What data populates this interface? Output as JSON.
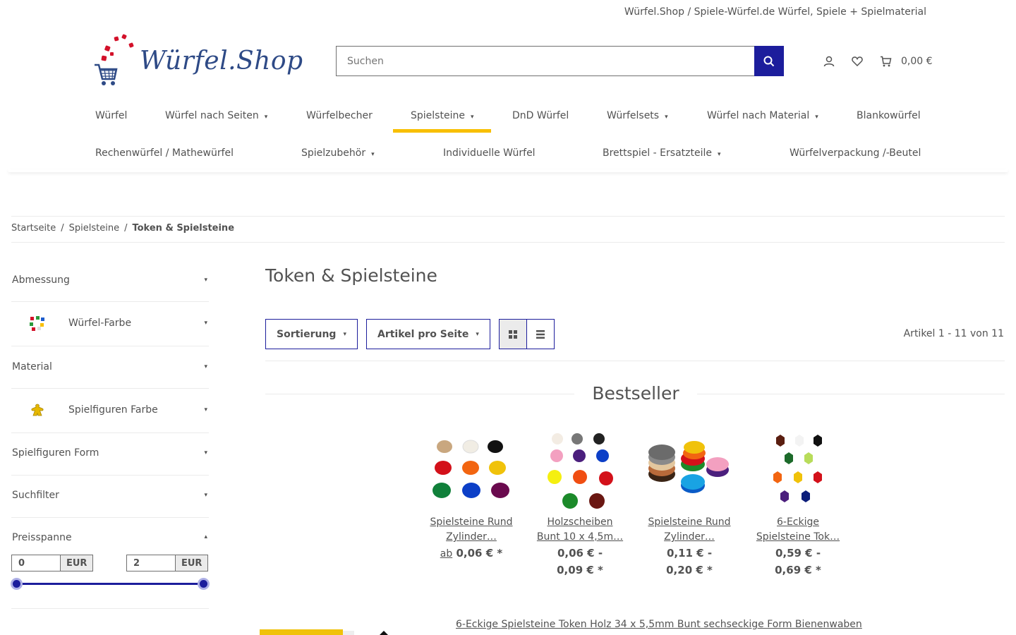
{
  "topbar": {
    "text": "Würfel.Shop / Spiele-Würfel.de Würfel, Spiele + Spielmaterial"
  },
  "logo": {
    "text": "Würfel.Shop"
  },
  "search": {
    "placeholder": "Suchen",
    "icon": "search-icon"
  },
  "header_icons": {
    "user": "user-icon",
    "wishlist": "heart-icon",
    "cart": "cart-icon",
    "cart_total": "0,00 €"
  },
  "nav": {
    "row1": [
      {
        "label": "Würfel",
        "has_children": false
      },
      {
        "label": "Würfel nach Seiten",
        "has_children": true
      },
      {
        "label": "Würfelbecher",
        "has_children": false
      },
      {
        "label": "Spielsteine",
        "has_children": true,
        "active": true
      },
      {
        "label": "DnD Würfel",
        "has_children": false
      },
      {
        "label": "Würfelsets",
        "has_children": true
      },
      {
        "label": "Würfel nach Material",
        "has_children": true
      },
      {
        "label": "Blankowürfel",
        "has_children": false
      }
    ],
    "row2": [
      {
        "label": "Rechenwürfel / Mathewürfel",
        "has_children": false
      },
      {
        "label": "Spielzubehör",
        "has_children": true
      },
      {
        "label": "Individuelle Würfel",
        "has_children": false
      },
      {
        "label": "Brettspiel - Ersatzteile",
        "has_children": true
      },
      {
        "label": "Würfelverpackung /-Beutel",
        "has_children": false
      }
    ],
    "accent_color": "#f8bf00"
  },
  "breadcrumb": {
    "items": [
      "Startseite",
      "Spielsteine",
      "Token & Spielsteine"
    ],
    "separator": "/"
  },
  "filters": [
    {
      "label": "Abmessung",
      "icon": null
    },
    {
      "label": "Würfel-Farbe",
      "icon": "colored-dice-icon"
    },
    {
      "label": "Material",
      "icon": null
    },
    {
      "label": "Spielfiguren Farbe",
      "icon": "meeple-icon"
    },
    {
      "label": "Spielfiguren Form",
      "icon": null
    },
    {
      "label": "Suchfilter",
      "icon": null
    },
    {
      "label": "Preisspanne",
      "icon": null
    }
  ],
  "price_range": {
    "min": "0",
    "max": "2",
    "currency": "EUR",
    "slider_min_fraction": 0,
    "slider_max_fraction": 1
  },
  "main": {
    "title": "Token & Spielsteine",
    "sort_label": "Sortierung",
    "per_page_label": "Artikel pro Seite",
    "view_grid_icon": "grid-icon",
    "view_list_icon": "list-icon",
    "count_text": "Artikel 1 - 11 von 11",
    "bestseller_heading": "Bestseller"
  },
  "products": [
    {
      "name1": "Spielsteine Rund",
      "name2": "Zylinder…",
      "prefix": "ab",
      "price1": "0,06 € *",
      "price2": ""
    },
    {
      "name1": "Holzscheiben",
      "name2": "Bunt 10 x 4,5m…",
      "prefix": "",
      "price1": "0,06 € -",
      "price2": "0,09 € *"
    },
    {
      "name1": "Spielsteine Rund",
      "name2": "Zylinder…",
      "prefix": "",
      "price1": "0,11 € -",
      "price2": "0,20 € *"
    },
    {
      "name1": "6-Eckige",
      "name2": "Spielsteine Tok…",
      "prefix": "",
      "price1": "0,59 € -",
      "price2": "0,69 € *"
    }
  ],
  "featured": {
    "link": "6-Eckige Spielsteine Token Holz 34 x 5,5mm Bunt sechseckige Form Bienenwaben"
  },
  "colors": {
    "primary": "#1c1d9c",
    "accent": "#f8bf00",
    "text": "#525252"
  }
}
